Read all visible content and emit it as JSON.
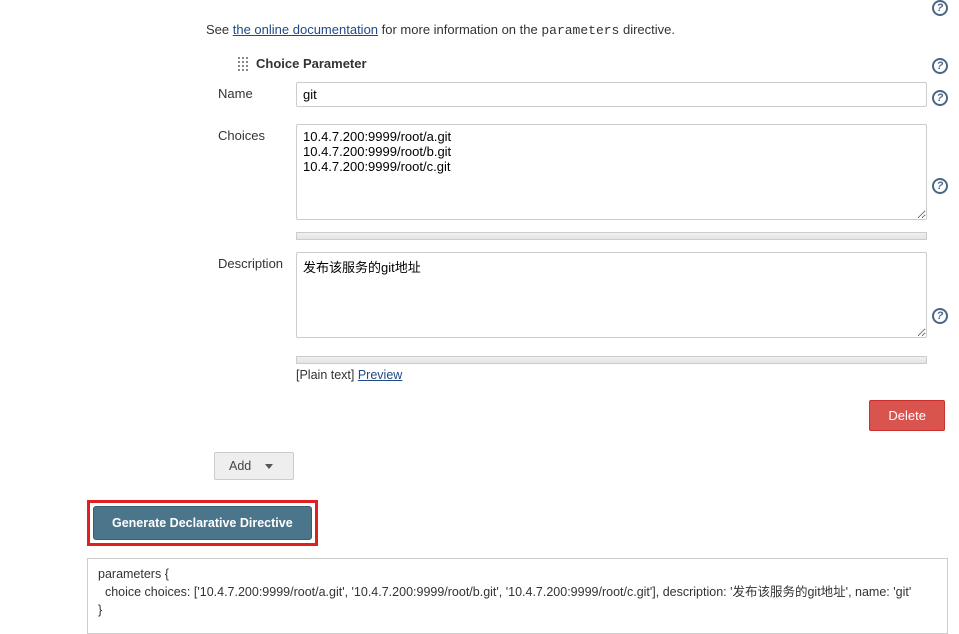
{
  "intro": {
    "prefix": "See ",
    "link_text": "the online documentation",
    "mid": " for more information on the ",
    "code": "parameters",
    "suffix": " directive."
  },
  "section": {
    "title": "Choice Parameter"
  },
  "fields": {
    "name_label": "Name",
    "name_value": "git",
    "choices_label": "Choices",
    "choices_value": "10.4.7.200:9999/root/a.git\n10.4.7.200:9999/root/b.git\n10.4.7.200:9999/root/c.git",
    "description_label": "Description",
    "description_value": "发布该服务的git地址",
    "format_label": "[Plain text] ",
    "preview_link": "Preview"
  },
  "buttons": {
    "delete": "Delete",
    "add": "Add",
    "generate": "Generate Declarative Directive"
  },
  "output": "parameters {\n  choice choices: ['10.4.7.200:9999/root/a.git', '10.4.7.200:9999/root/b.git', '10.4.7.200:9999/root/c.git'], description: '发布该服务的git地址', name: 'git'\n}",
  "icons": {
    "help": "?"
  }
}
